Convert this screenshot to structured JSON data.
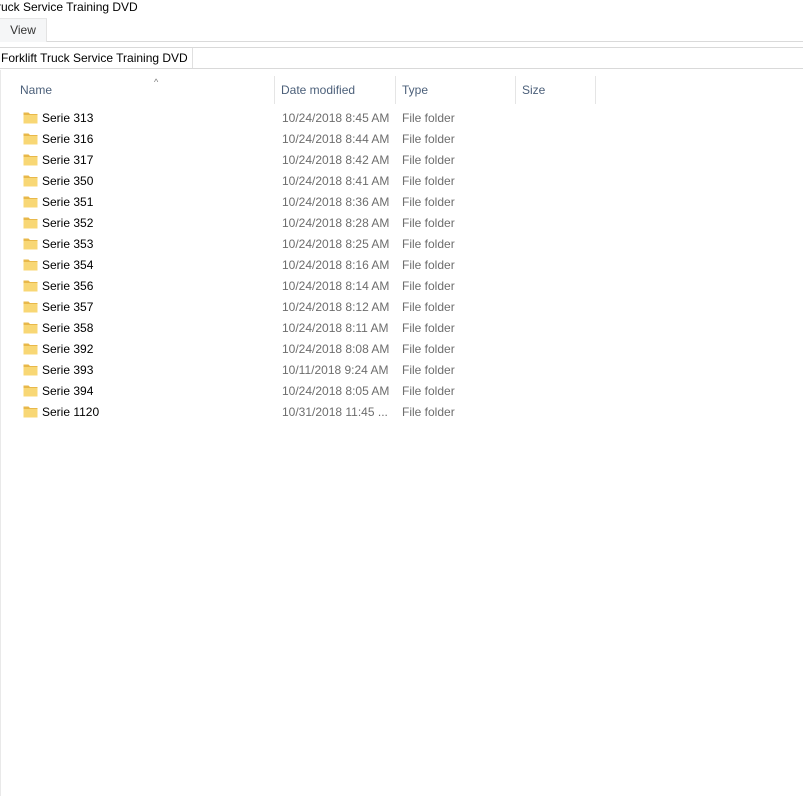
{
  "window": {
    "title": "ruck Service Training DVD"
  },
  "ribbon": {
    "tabs": [
      {
        "label": "View"
      }
    ]
  },
  "address": {
    "segment": "Forklift Truck Service Training DVD"
  },
  "columns": {
    "name": "Name",
    "date": "Date modified",
    "type": "Type",
    "size": "Size",
    "sort_indicator": "^"
  },
  "icons": {
    "folder": "folder-icon"
  },
  "colors": {
    "folder_body": "#f8d775",
    "folder_back": "#e8b84a",
    "header_text": "#4c607a",
    "muted_text": "#6d6d6d"
  },
  "rows": [
    {
      "name": "Serie 313",
      "date": "10/24/2018 8:45 AM",
      "type": "File folder",
      "size": ""
    },
    {
      "name": "Serie 316",
      "date": "10/24/2018 8:44 AM",
      "type": "File folder",
      "size": ""
    },
    {
      "name": "Serie 317",
      "date": "10/24/2018 8:42 AM",
      "type": "File folder",
      "size": ""
    },
    {
      "name": "Serie 350",
      "date": "10/24/2018 8:41 AM",
      "type": "File folder",
      "size": ""
    },
    {
      "name": "Serie 351",
      "date": "10/24/2018 8:36 AM",
      "type": "File folder",
      "size": ""
    },
    {
      "name": "Serie 352",
      "date": "10/24/2018 8:28 AM",
      "type": "File folder",
      "size": ""
    },
    {
      "name": "Serie 353",
      "date": "10/24/2018 8:25 AM",
      "type": "File folder",
      "size": ""
    },
    {
      "name": "Serie 354",
      "date": "10/24/2018 8:16 AM",
      "type": "File folder",
      "size": ""
    },
    {
      "name": "Serie 356",
      "date": "10/24/2018 8:14 AM",
      "type": "File folder",
      "size": ""
    },
    {
      "name": "Serie 357",
      "date": "10/24/2018 8:12 AM",
      "type": "File folder",
      "size": ""
    },
    {
      "name": "Serie 358",
      "date": "10/24/2018 8:11 AM",
      "type": "File folder",
      "size": ""
    },
    {
      "name": "Serie 392",
      "date": "10/24/2018 8:08 AM",
      "type": "File folder",
      "size": ""
    },
    {
      "name": "Serie 393",
      "date": "10/11/2018 9:24 AM",
      "type": "File folder",
      "size": ""
    },
    {
      "name": "Serie 394",
      "date": "10/24/2018 8:05 AM",
      "type": "File folder",
      "size": ""
    },
    {
      "name": "Serie 1120",
      "date": "10/31/2018 11:45 ...",
      "type": "File folder",
      "size": ""
    }
  ]
}
